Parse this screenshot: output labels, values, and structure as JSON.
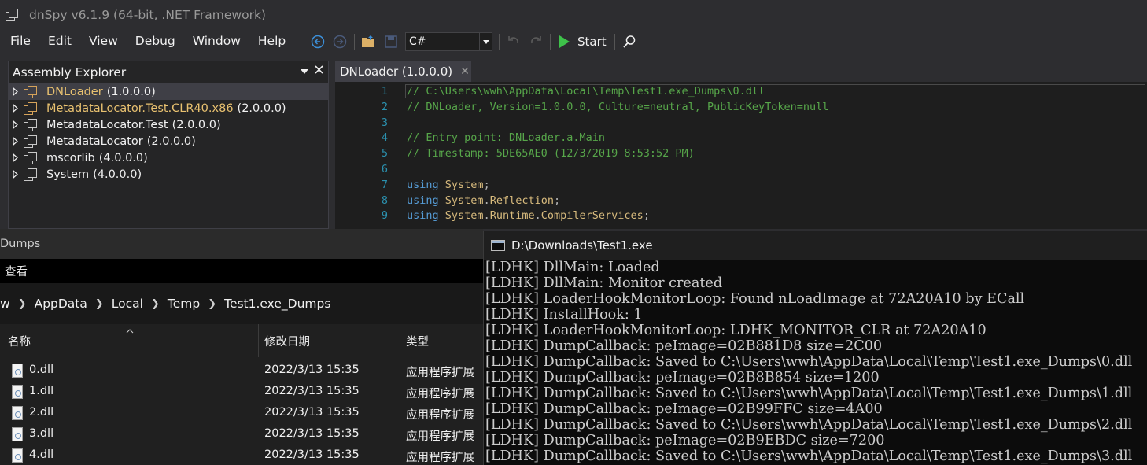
{
  "dnspy": {
    "title": "dnSpy v6.1.9 (64-bit, .NET Framework)",
    "menu": [
      "File",
      "Edit",
      "View",
      "Debug",
      "Window",
      "Help"
    ],
    "toolbar": {
      "language": "C#",
      "start_label": "Start",
      "icons": [
        "back-icon",
        "forward-icon",
        "open-folder-icon",
        "save-icon",
        "undo-icon",
        "redo-icon",
        "play-icon",
        "search-icon"
      ]
    },
    "assembly_explorer": {
      "title": "Assembly Explorer",
      "items": [
        {
          "name": "DNLoader",
          "version": "(1.0.0.0)",
          "gold": true,
          "selected": true
        },
        {
          "name": "MetadataLocator.Test.CLR40.x86",
          "version": "(2.0.0.0)",
          "gold": true,
          "selected": false
        },
        {
          "name": "MetadataLocator.Test",
          "version": "(2.0.0.0)",
          "gold": false,
          "selected": false
        },
        {
          "name": "MetadataLocator",
          "version": "(2.0.0.0)",
          "gold": false,
          "selected": false
        },
        {
          "name": "mscorlib",
          "version": "(4.0.0.0)",
          "gold": false,
          "selected": false
        },
        {
          "name": "System",
          "version": "(4.0.0.0)",
          "gold": false,
          "selected": false
        }
      ]
    },
    "editor": {
      "tab_label": "DNLoader (1.0.0.0)",
      "lines": [
        {
          "n": "1",
          "kind": "comment",
          "text": "// C:\\Users\\wwh\\AppData\\Local\\Temp\\Test1.exe_Dumps\\0.dll"
        },
        {
          "n": "2",
          "kind": "comment",
          "text": "// DNLoader, Version=1.0.0.0, Culture=neutral, PublicKeyToken=null"
        },
        {
          "n": "3",
          "kind": "empty",
          "text": ""
        },
        {
          "n": "4",
          "kind": "comment",
          "text": "// Entry point: DNLoader.a.Main"
        },
        {
          "n": "5",
          "kind": "comment",
          "text": "// Timestamp: 5DE65AE0 (12/3/2019 8:53:52 PM)"
        },
        {
          "n": "6",
          "kind": "empty",
          "text": ""
        },
        {
          "n": "7",
          "kind": "using",
          "keyword": "using",
          "ns": "System",
          "end": ";"
        },
        {
          "n": "8",
          "kind": "using",
          "keyword": "using",
          "ns": "System.Reflection",
          "end": ";"
        },
        {
          "n": "9",
          "kind": "using",
          "keyword": "using",
          "ns": "System.Runtime.CompilerServices",
          "end": ";"
        }
      ]
    }
  },
  "explorer": {
    "title": "Dumps",
    "ribbon_label": "查看",
    "breadcrumb": [
      "w",
      "AppData",
      "Local",
      "Temp",
      "Test1.exe_Dumps"
    ],
    "columns": [
      "名称",
      "修改日期",
      "类型"
    ],
    "files": [
      {
        "name": "0.dll",
        "date": "2022/3/13 15:35",
        "type": "应用程序扩展"
      },
      {
        "name": "1.dll",
        "date": "2022/3/13 15:35",
        "type": "应用程序扩展"
      },
      {
        "name": "2.dll",
        "date": "2022/3/13 15:35",
        "type": "应用程序扩展"
      },
      {
        "name": "3.dll",
        "date": "2022/3/13 15:35",
        "type": "应用程序扩展"
      },
      {
        "name": "4.dll",
        "date": "2022/3/13 15:35",
        "type": "应用程序扩展"
      }
    ]
  },
  "console": {
    "title": "D:\\Downloads\\Test1.exe",
    "lines": [
      "[LDHK] DllMain: Loaded",
      "[LDHK] DllMain: Monitor created",
      "[LDHK] LoaderHookMonitorLoop: Found nLoadImage at 72A20A10 by ECall",
      "[LDHK] InstallHook: 1",
      "[LDHK] LoaderHookMonitorLoop: LDHK_MONITOR_CLR at 72A20A10",
      "[LDHK] DumpCallback: peImage=02B881D8 size=2C00",
      "[LDHK] DumpCallback: Saved to C:\\Users\\wwh\\AppData\\Local\\Temp\\Test1.exe_Dumps\\0.dll",
      "[LDHK] DumpCallback: peImage=02B8B854 size=1200",
      "[LDHK] DumpCallback: Saved to C:\\Users\\wwh\\AppData\\Local\\Temp\\Test1.exe_Dumps\\1.dll",
      "[LDHK] DumpCallback: peImage=02B99FFC size=4A00",
      "[LDHK] DumpCallback: Saved to C:\\Users\\wwh\\AppData\\Local\\Temp\\Test1.exe_Dumps\\2.dll",
      "[LDHK] DumpCallback: peImage=02B9EBDC size=7200",
      "[LDHK] DumpCallback: Saved to C:\\Users\\wwh\\AppData\\Local\\Temp\\Test1.exe_Dumps\\3.dll"
    ]
  }
}
